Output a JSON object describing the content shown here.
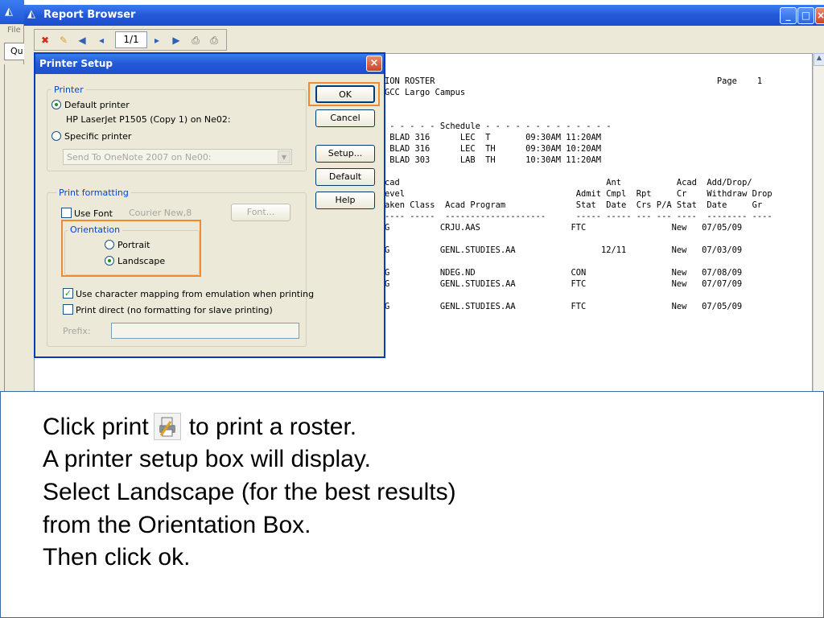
{
  "back_window": {
    "file_menu": "File",
    "tab_label": "Qu"
  },
  "report_browser": {
    "title": "Report Browser",
    "page_field": "1/1"
  },
  "report": {
    "lines": [
      "ION ROSTER                                                        Page    1",
      "GCC Largo Campus",
      "",
      "",
      " - - - - - Schedule - - - - - - - - - - - - -",
      " BLAD 316      LEC  T       09:30AM 11:20AM",
      " BLAD 316      LEC  TH      09:30AM 10:20AM",
      " BLAD 303      LAB  TH      10:30AM 11:20AM",
      "",
      "cad                                         Ant           Acad  Add/Drop/",
      "evel                                  Admit Cmpl  Rpt     Cr    Withdraw Drop",
      "aken Class  Acad Program              Stat  Date  Crs P/A Stat  Date     Gr",
      "---- -----  --------------------      ----- ----- --- --- ----  -------- ----",
      "G          CRJU.AAS                  FTC                 New   07/05/09",
      "",
      "G          GENL.STUDIES.AA                 12/11         New   07/03/09",
      "",
      "G          NDEG.ND                   CON                 New   07/08/09",
      "G          GENL.STUDIES.AA           FTC                 New   07/07/09",
      "",
      "G          GENL.STUDIES.AA           FTC                 New   07/05/09"
    ]
  },
  "dialog": {
    "title": "Printer Setup",
    "printer_group": "Printer",
    "default_printer": "Default printer",
    "default_printer_name": "HP LaserJet P1505 (Copy 1) on Ne02:",
    "specific_printer": "Specific printer",
    "specific_printer_value": "Send To OneNote 2007 on Ne00:",
    "print_formatting_group": "Print formatting",
    "use_font": "Use Font",
    "font_name": "Courier New,8",
    "font_button": "Font...",
    "orientation_group": "Orientation",
    "portrait": "Portrait",
    "landscape": "Landscape",
    "use_char_mapping": "Use character mapping from emulation when printing",
    "print_direct": "Print direct (no formatting for slave printing)",
    "prefix": "Prefix:",
    "buttons": {
      "ok": "OK",
      "cancel": "Cancel",
      "setup": "Setup...",
      "default": "Default",
      "help": "Help"
    }
  },
  "instructions": {
    "line1_before": "Click print",
    "line1_after": "to print a roster.",
    "line2": "A printer setup box will display.",
    "line3": "Select Landscape (for the best results)",
    "line4": "from the Orientation Box.",
    "line5": "Then click ok."
  },
  "colors": {
    "highlight": "#f08a2e",
    "titlebar": "#2358d7"
  }
}
